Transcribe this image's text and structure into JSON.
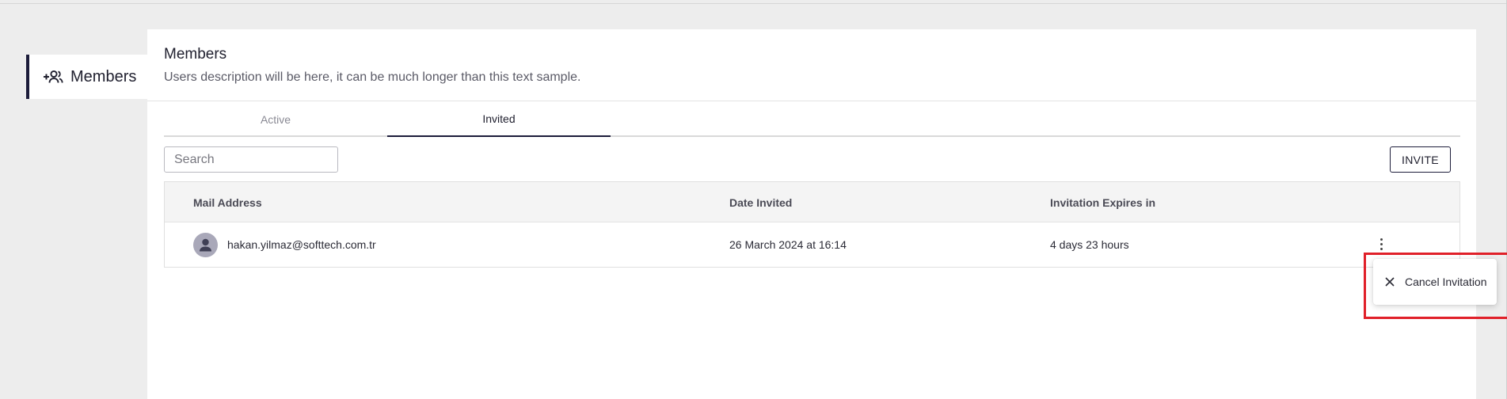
{
  "sidebar": {
    "items": [
      {
        "label": "Members",
        "icon": "add-group-icon"
      }
    ]
  },
  "header": {
    "title": "Members",
    "description": "Users description will be here, it can be much longer than this text sample."
  },
  "tabs": [
    {
      "label": "Active",
      "selected": false
    },
    {
      "label": "Invited",
      "selected": true
    }
  ],
  "search": {
    "placeholder": "Search",
    "value": ""
  },
  "toolbar": {
    "invite_label": "INVITE"
  },
  "table": {
    "columns": [
      "Mail Address",
      "Date Invited",
      "Invitation Expires in"
    ],
    "rows": [
      {
        "email": "hakan.yilmaz@softtech.com.tr",
        "date_invited": "26 March 2024 at 16:14",
        "expires_in": "4 days 23 hours"
      }
    ]
  },
  "context_menu": {
    "items": [
      {
        "label": "Cancel Invitation",
        "icon": "close-icon"
      }
    ]
  },
  "colors": {
    "accent": "#1c1c3a",
    "highlight": "#e02029",
    "page_background": "#ededed"
  }
}
